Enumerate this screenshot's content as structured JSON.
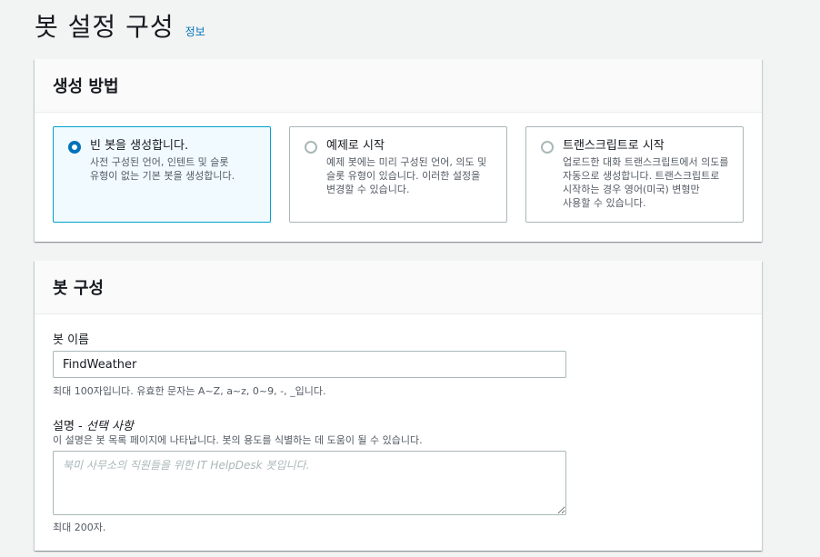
{
  "header": {
    "title": "봇 설정 구성",
    "info_link": "정보"
  },
  "creation_method": {
    "title": "생성 방법",
    "options": [
      {
        "label": "빈 봇을 생성합니다.",
        "description": "사전 구성된 언어, 인텐트 및 슬롯 유형이 없는 기본 봇을 생성합니다.",
        "selected": true
      },
      {
        "label": "예제로 시작",
        "description": "예제 봇에는 미리 구성된 언어, 의도 및 슬롯 유형이 있습니다. 이러한 설정을 변경할 수 있습니다.",
        "selected": false
      },
      {
        "label": "트랜스크립트로 시작",
        "description": "업로드한 대화 트랜스크립트에서 의도를 자동으로 생성합니다. 트랜스크립트로 시작하는 경우 영어(미국) 변형만 사용할 수 있습니다.",
        "selected": false
      }
    ]
  },
  "bot_config": {
    "title": "봇 구성",
    "name_label": "봇 이름",
    "name_value": "FindWeather",
    "name_hint": "최대 100자입니다. 유효한 문자는 A~Z, a~z, 0~9, -, _입니다.",
    "description_label": "설명 - ",
    "description_optional": "선택 사항",
    "description_help": "이 설명은 봇 목록 페이지에 나타납니다. 봇의 용도를 식별하는 데 도움이 될 수 있습니다.",
    "description_placeholder": "북미 사무소의 직원들을 위한 IT HelpDesk 봇입니다.",
    "description_hint": "최대 200자."
  }
}
